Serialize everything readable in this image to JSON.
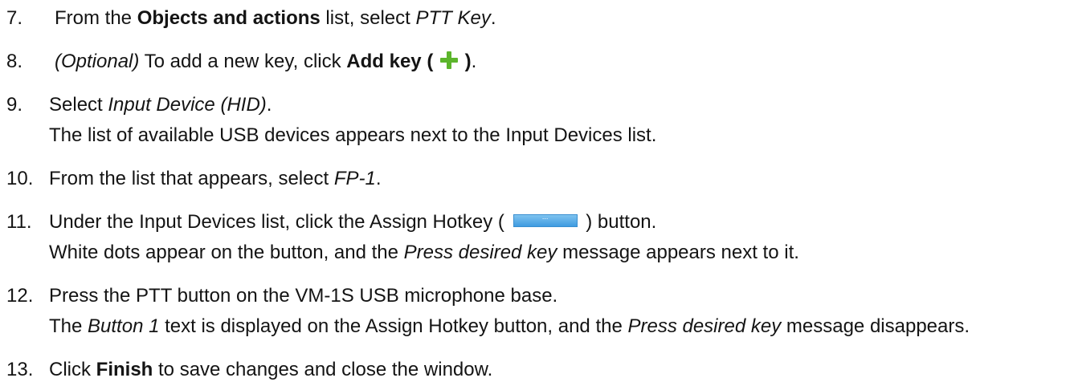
{
  "steps": [
    {
      "number": "7.",
      "lines": [
        {
          "t1": "From the ",
          "b1": "Objects and actions",
          "t2": " list, select ",
          "i1": "PTT Key",
          "t3": "."
        }
      ]
    },
    {
      "number": "8.",
      "lines": [
        {
          "i1": "(Optional)",
          "t1": " To add a new key, click ",
          "b1": "Add key (",
          "icon": "add-plus-icon",
          "b2": ")",
          "t2": "."
        }
      ]
    },
    {
      "number": "9.",
      "lines": [
        {
          "t1": "Select ",
          "i1": "Input Device (HID)",
          "t2": "."
        },
        {
          "t1": "The list of available USB devices appears next to the Input Devices list."
        }
      ]
    },
    {
      "number": "10.",
      "lines": [
        {
          "t1": "From the list that appears, select ",
          "i1": "FP-1",
          "t2": "."
        }
      ]
    },
    {
      "number": "11.",
      "lines": [
        {
          "t1": "Under the Input Devices list, click the Assign Hotkey (",
          "button_text": "...",
          "t2": ") button."
        },
        {
          "t1": "White dots appear on the button, and the ",
          "i1": "Press desired key",
          "t2": " message appears next to it."
        }
      ]
    },
    {
      "number": "12.",
      "lines": [
        {
          "t1": "Press the PTT button on the VM-1S USB microphone base."
        },
        {
          "t1": "The ",
          "i1": "Button 1",
          "t2": " text is displayed on the Assign Hotkey button, and the ",
          "i2": "Press desired key",
          "t3": " message disappears."
        }
      ]
    },
    {
      "number": "13.",
      "lines": [
        {
          "t1": "Click ",
          "b1": "Finish",
          "t2": " to save changes and close the window."
        }
      ]
    }
  ],
  "colors": {
    "text": "#141414",
    "plus_icon": "#5cb52c",
    "hotkey_button": "#4aa3e6"
  }
}
